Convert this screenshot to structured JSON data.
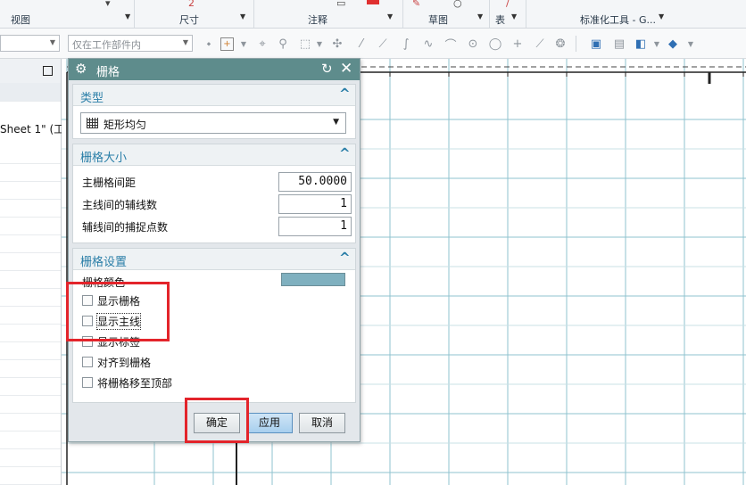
{
  "ribbon": {
    "groups": [
      {
        "label": "视图"
      },
      {
        "label": "尺寸"
      },
      {
        "label": "注释"
      },
      {
        "label": "草图"
      },
      {
        "label": "表"
      },
      {
        "label": "标准化工具 - G..."
      }
    ]
  },
  "toolbar": {
    "filter_value": "",
    "scope_value": "仅在工作部件内"
  },
  "navigator": {
    "sheet_label": "Sheet 1\" (工"
  },
  "dialog": {
    "title": "栅格",
    "type_section": {
      "title": "类型",
      "selected": "矩形均匀"
    },
    "size_section": {
      "title": "栅格大小",
      "fields": [
        {
          "label": "主栅格间距",
          "value": "50.0000"
        },
        {
          "label": "主线间的辅线数",
          "value": "1"
        },
        {
          "label": "辅线间的捕捉点数",
          "value": "1"
        }
      ]
    },
    "settings_section": {
      "title": "栅格设置",
      "color_label": "栅格颜色",
      "color_value": "#7fb0bf",
      "checkboxes": [
        {
          "label": "显示栅格",
          "checked": false
        },
        {
          "label": "显示主线",
          "checked": false
        },
        {
          "label": "显示标签",
          "checked": false
        },
        {
          "label": "对齐到栅格",
          "checked": false
        },
        {
          "label": "将栅格移至顶部",
          "checked": false
        }
      ]
    },
    "buttons": {
      "ok": "确定",
      "apply": "应用",
      "cancel": "取消"
    }
  },
  "colors": {
    "titlebar": "#5e8c8c",
    "section_title": "#2b7fa8",
    "highlight": "#e3242b",
    "grid_line": "#8fc3cf"
  },
  "icons": [
    "gear-icon",
    "reset-icon",
    "close-icon",
    "collapse-icon",
    "grid-pattern-icon",
    "dropdown-arrow-icon",
    "maximize-icon"
  ]
}
